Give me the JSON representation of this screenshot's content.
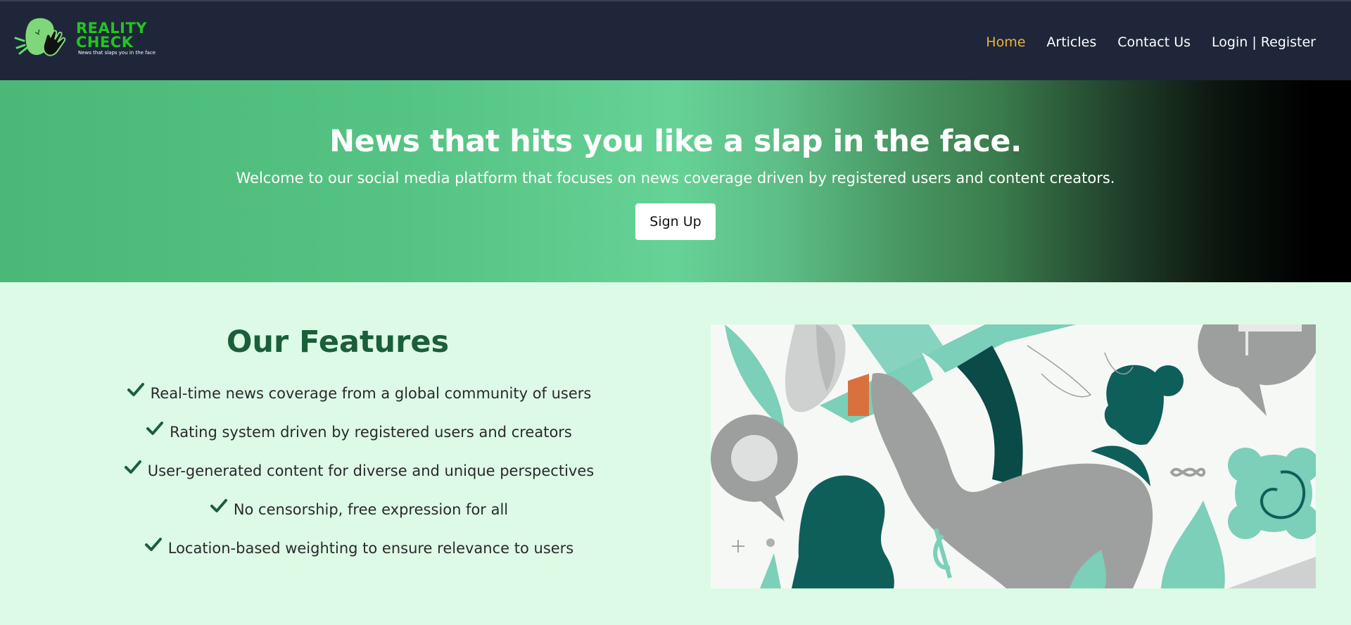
{
  "logo": {
    "title": "REALITY\nCHECK",
    "tagline": "News that slaps you in the face",
    "icon": "slapped-face-logo-icon"
  },
  "nav": {
    "items": [
      {
        "label": "Home",
        "active": true
      },
      {
        "label": "Articles",
        "active": false
      },
      {
        "label": "Contact Us",
        "active": false
      },
      {
        "label": "Login | Register",
        "active": false
      }
    ]
  },
  "hero": {
    "title": "News that hits you like a slap in the face.",
    "subtitle": "Welcome to our social media platform that focuses on news coverage driven by registered users and content creators.",
    "cta_label": "Sign Up"
  },
  "features": {
    "title": "Our Features",
    "items": [
      "Real-time news coverage from a global community of users",
      "Rating system driven by registered users and creators",
      "User-generated content for diverse and unique perspectives",
      "No censorship, free expression for all",
      "Location-based weighting to ensure relevance to users"
    ],
    "check_icon": "checkmark-icon"
  },
  "illustration": {
    "icon": "megaphone-person-illustration"
  },
  "colors": {
    "nav_bg": "#1f2639",
    "brand_green": "#22c520",
    "active_link": "#eeb238",
    "features_bg": "#dcfae6",
    "features_title": "#1b5e3a",
    "teal": "#0e5f5a",
    "mint": "#7ccfb8"
  }
}
